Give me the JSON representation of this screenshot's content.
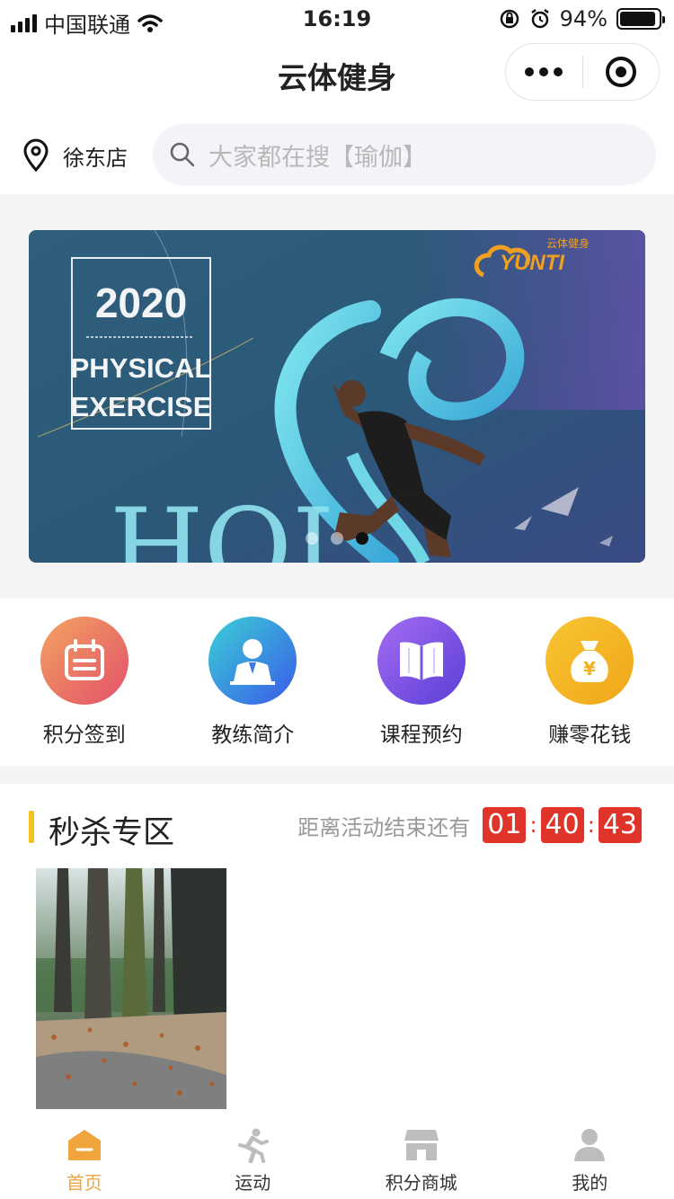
{
  "status_bar": {
    "carrier": "中国联通",
    "time": "16:19",
    "battery": "94%",
    "battery_level": 0.94
  },
  "nav": {
    "title": "云体健身"
  },
  "location": {
    "store": "徐东店"
  },
  "search": {
    "placeholder": "大家都在搜【瑜伽】"
  },
  "banner": {
    "year": "2020",
    "line1": "PHYSICAL",
    "line2": "EXERCISE",
    "brand_cn": "云体健身",
    "brand_en": "YUNTI",
    "slides": 3,
    "active_slide": 3
  },
  "grid": [
    {
      "label": "积分签到",
      "icon": "calendar-icon",
      "color": "#ee6a6a"
    },
    {
      "label": "教练简介",
      "icon": "coach-icon",
      "color": "#3d7fe8"
    },
    {
      "label": "课程预约",
      "icon": "book-icon",
      "color": "#7550e0"
    },
    {
      "label": "赚零花钱",
      "icon": "money-bag-icon",
      "color": "#f2b21c"
    }
  ],
  "seckill": {
    "title": "秒杀专区",
    "countdown_label": "距离活动结束还有",
    "hours": "01",
    "minutes": "40",
    "seconds": "43"
  },
  "tabs": [
    {
      "label": "首页",
      "icon": "home-icon",
      "active": true
    },
    {
      "label": "运动",
      "icon": "run-icon",
      "active": false
    },
    {
      "label": "积分商城",
      "icon": "store-icon",
      "active": false
    },
    {
      "label": "我的",
      "icon": "user-icon",
      "active": false
    }
  ],
  "colors": {
    "accent": "#f0a43c",
    "countdown": "#e0342a",
    "section_bar": "#f2c21b"
  }
}
